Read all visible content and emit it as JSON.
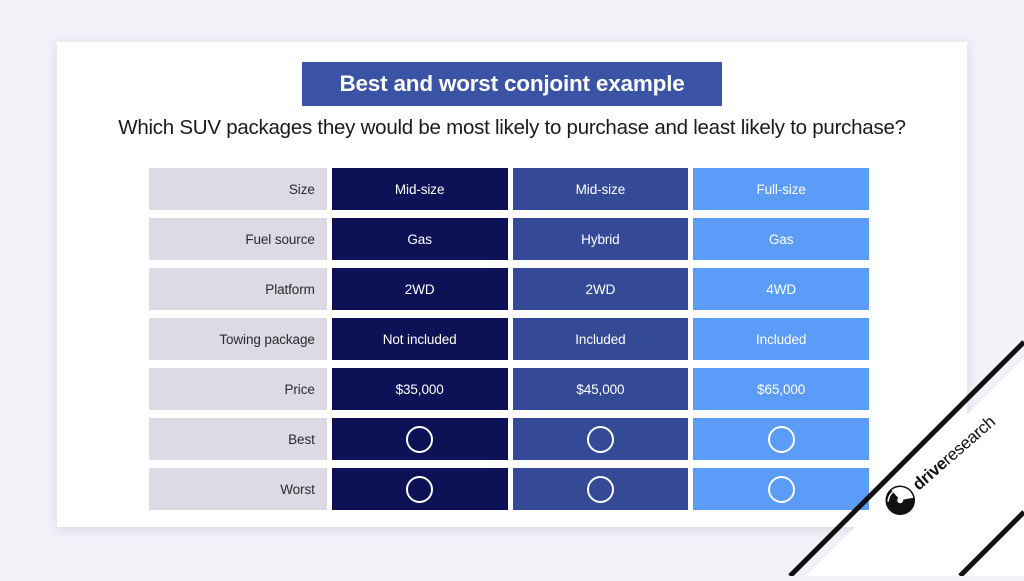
{
  "slide": {
    "title": "Best and worst conjoint example",
    "subtitle": "Which SUV packages they would be most likely to purchase and least likely to purchase?"
  },
  "colors": {
    "page_background": "#f2f1f7",
    "card_background": "#ffffff",
    "title_banner": "#3a53a4",
    "label_cell": "#dcdae4",
    "column_a": "#0d1155",
    "column_b": "#354a96",
    "column_c": "#5b9cf8",
    "ring_stroke": "#ffffff"
  },
  "matrix": {
    "row_labels": [
      "Size",
      "Fuel source",
      "Platform",
      "Towing package",
      "Price",
      "Best",
      "Worst"
    ],
    "columns": [
      {
        "key": "col-a",
        "values": [
          "Mid-size",
          "Gas",
          "2WD",
          "Not included",
          "$35,000",
          "",
          ""
        ]
      },
      {
        "key": "col-b",
        "values": [
          "Mid-size",
          "Hybrid",
          "2WD",
          "Included",
          "$45,000",
          "",
          ""
        ]
      },
      {
        "key": "col-c",
        "values": [
          "Full-size",
          "Gas",
          "4WD",
          "Included",
          "$65,000",
          "",
          ""
        ]
      }
    ],
    "ring_rows": [
      5,
      6
    ]
  },
  "logo": {
    "mark": "sphere-globe-icon",
    "word_bold": "drive",
    "word_light": "research"
  }
}
